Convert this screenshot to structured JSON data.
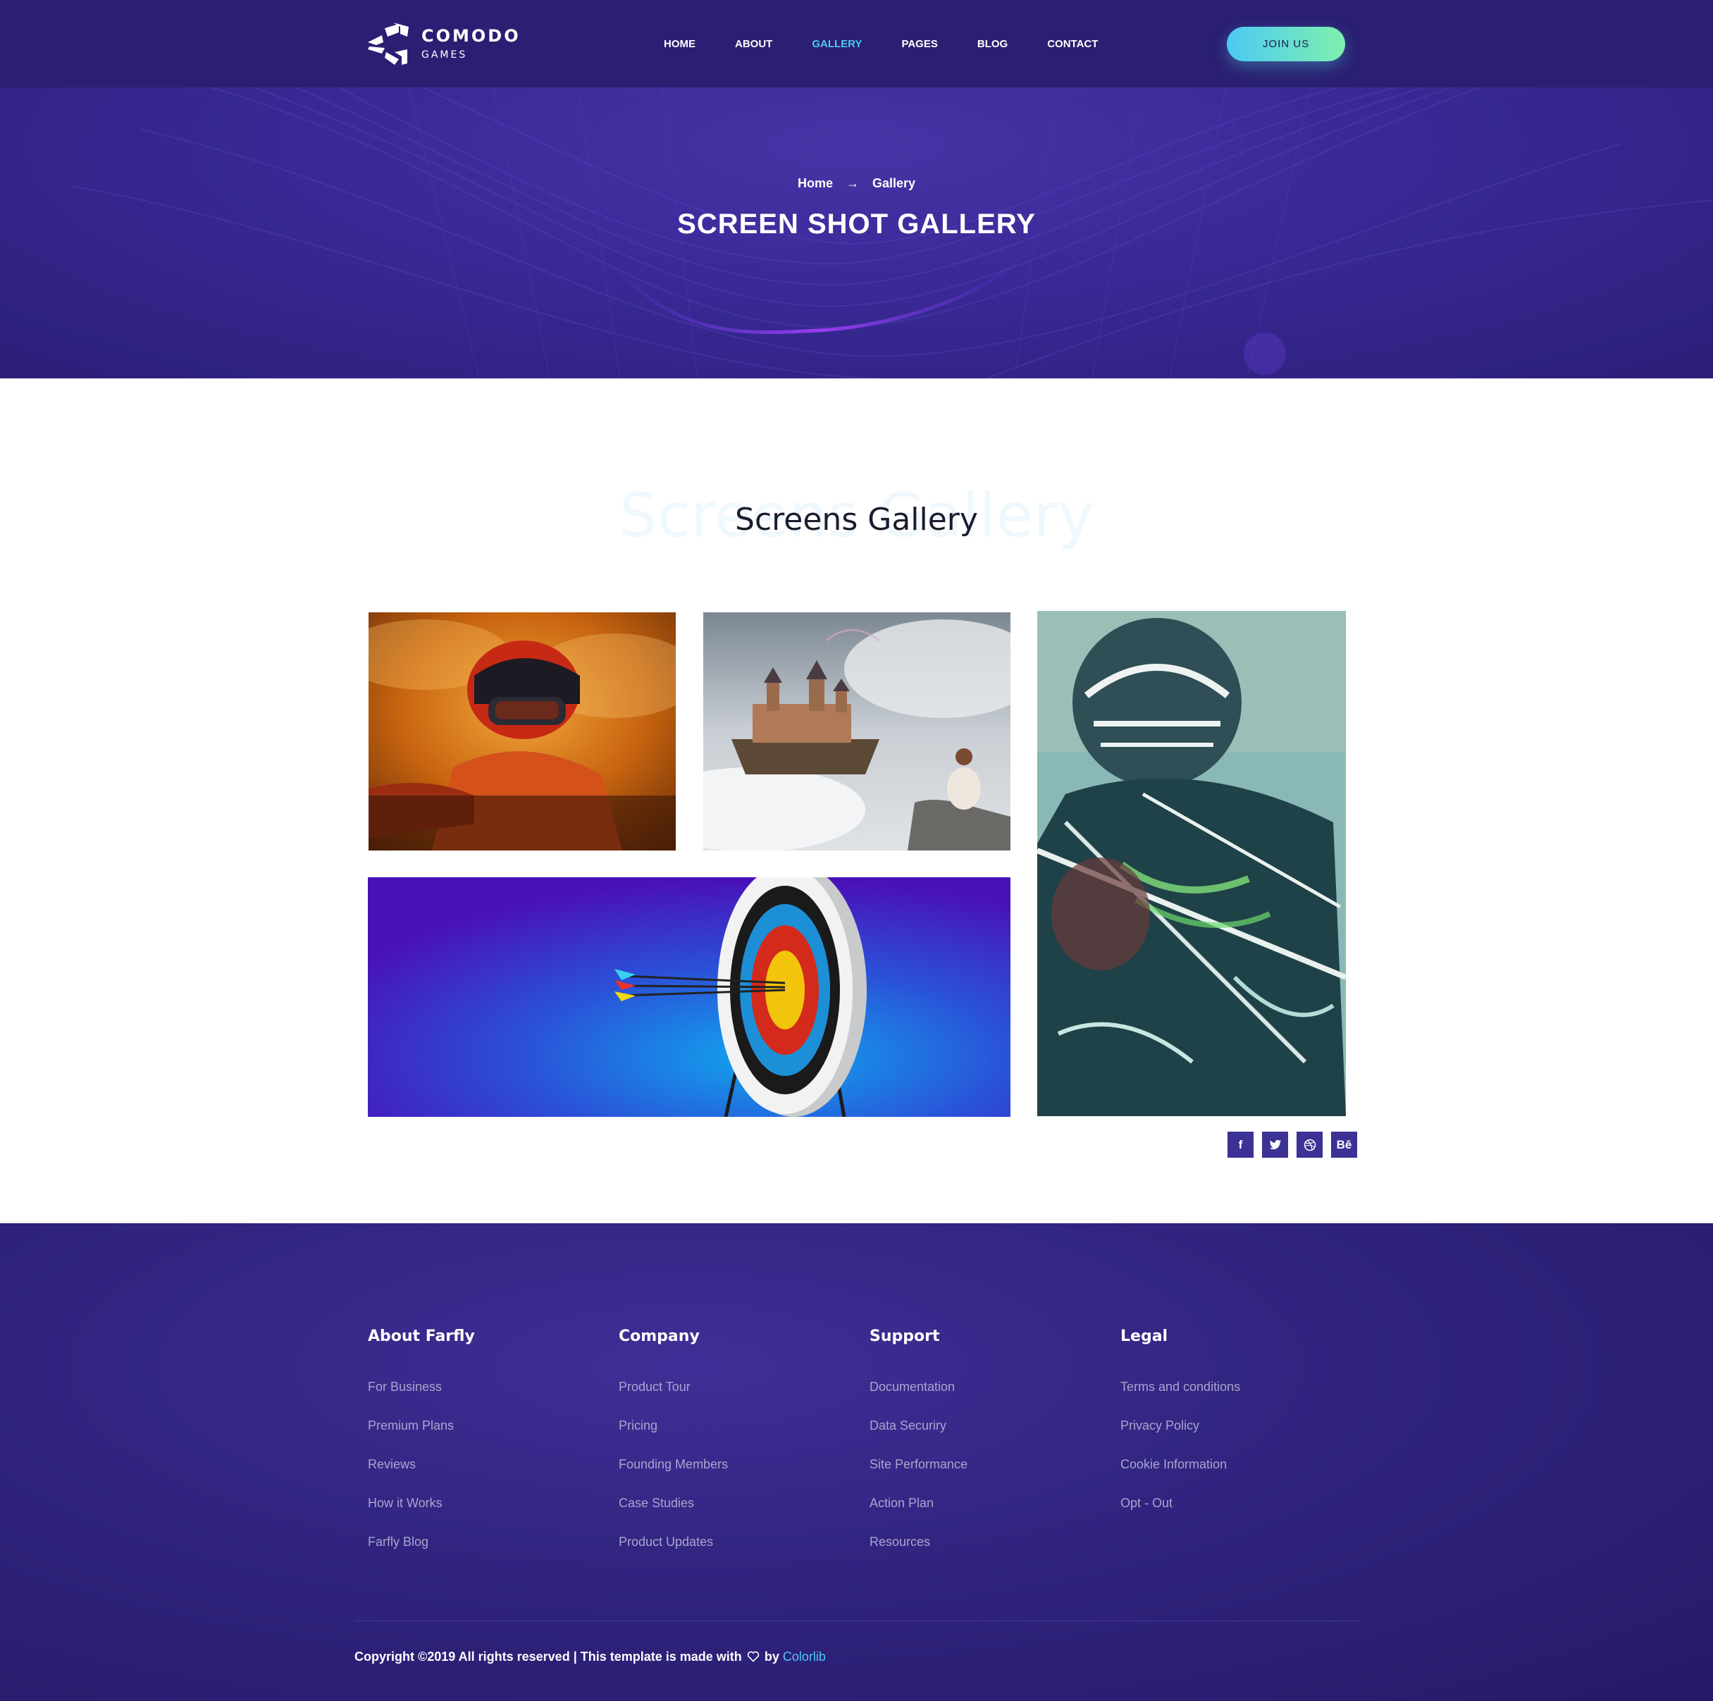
{
  "brand": {
    "name": "COMODO",
    "tagline": "GAMES"
  },
  "nav": {
    "items": [
      "HOME",
      "ABOUT",
      "GALLERY",
      "PAGES",
      "BLOG",
      "CONTACT"
    ],
    "active": "GALLERY"
  },
  "header": {
    "cta_label": "JOIN US"
  },
  "hero": {
    "breadcrumb": [
      "Home",
      "Gallery"
    ],
    "title": "SCREEN SHOT GALLERY"
  },
  "gallery": {
    "bg_title": "Screens Gallery",
    "title": "Screens Gallery",
    "images": [
      "motocross-rider",
      "floating-castle",
      "football-player",
      "archery-target"
    ]
  },
  "footer": {
    "columns": [
      {
        "title": "About Farfly",
        "links": [
          "For Business",
          "Premium Plans",
          "Reviews",
          "How it Works",
          "Farfly Blog"
        ]
      },
      {
        "title": "Company",
        "links": [
          "Product Tour",
          "Pricing",
          "Founding Members",
          "Case Studies",
          "Product Updates"
        ]
      },
      {
        "title": "Support",
        "links": [
          "Documentation",
          "Data Securiry",
          "Site Performance",
          "Action Plan",
          "Resources"
        ]
      },
      {
        "title": "Legal",
        "links": [
          "Terms and conditions",
          "Privacy Policy",
          "Cookie Information",
          "Opt - Out"
        ]
      }
    ],
    "copyright_prefix": "Copyright ©2019 All rights reserved | This template is made with",
    "copyright_by": "by",
    "copyright_brand": "Colorlib",
    "social": {
      "facebook": "f",
      "behance": "Bē"
    }
  },
  "colors": {
    "header_bg": "#2a1f72",
    "accent": "#4fc7f5",
    "cta_gradient": [
      "#4cc9f5",
      "#7ff0ad"
    ],
    "footer_link": "#a9a4cf"
  }
}
